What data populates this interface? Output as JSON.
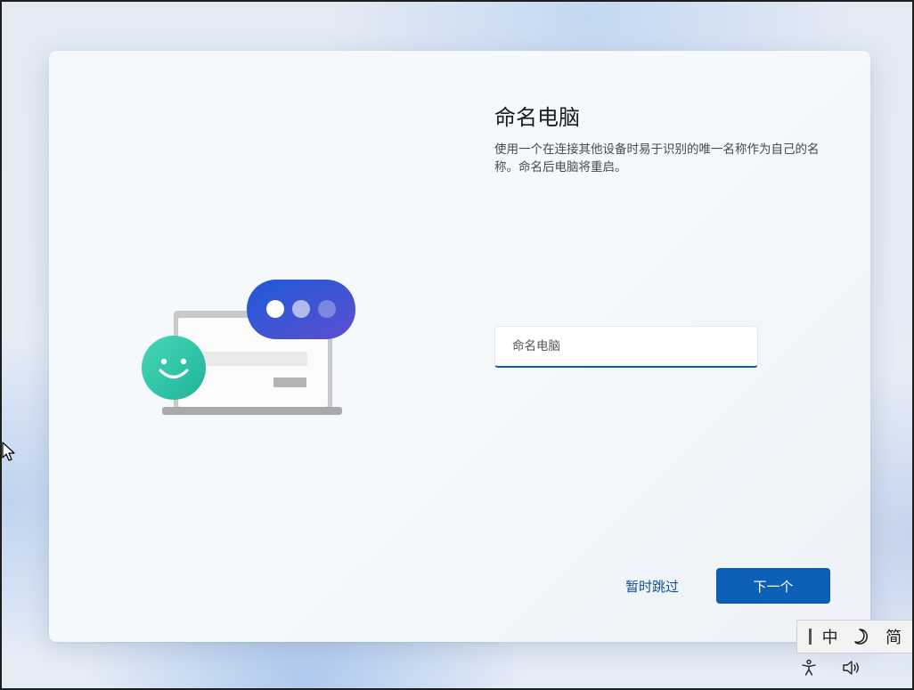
{
  "page": {
    "title": "命名电脑",
    "description": "使用一个在连接其他设备时易于识别的唯一名称作为自己的名称。命名后电脑将重启。"
  },
  "name_input": {
    "placeholder": "命名电脑",
    "value": ""
  },
  "buttons": {
    "skip": "暂时跳过",
    "next": "下一个"
  },
  "ime_toolbar": {
    "language": "中",
    "mode_icon": "moon-icon",
    "variant": "简"
  },
  "tray": {
    "icons": [
      "accessibility-icon",
      "volume-icon"
    ]
  },
  "colors": {
    "accent": "#0d5fb8",
    "link": "#0f4f99",
    "bubble_start": "#1f5ad6",
    "bubble_end": "#5b4fd1",
    "smiley": "#2ec8a8"
  }
}
